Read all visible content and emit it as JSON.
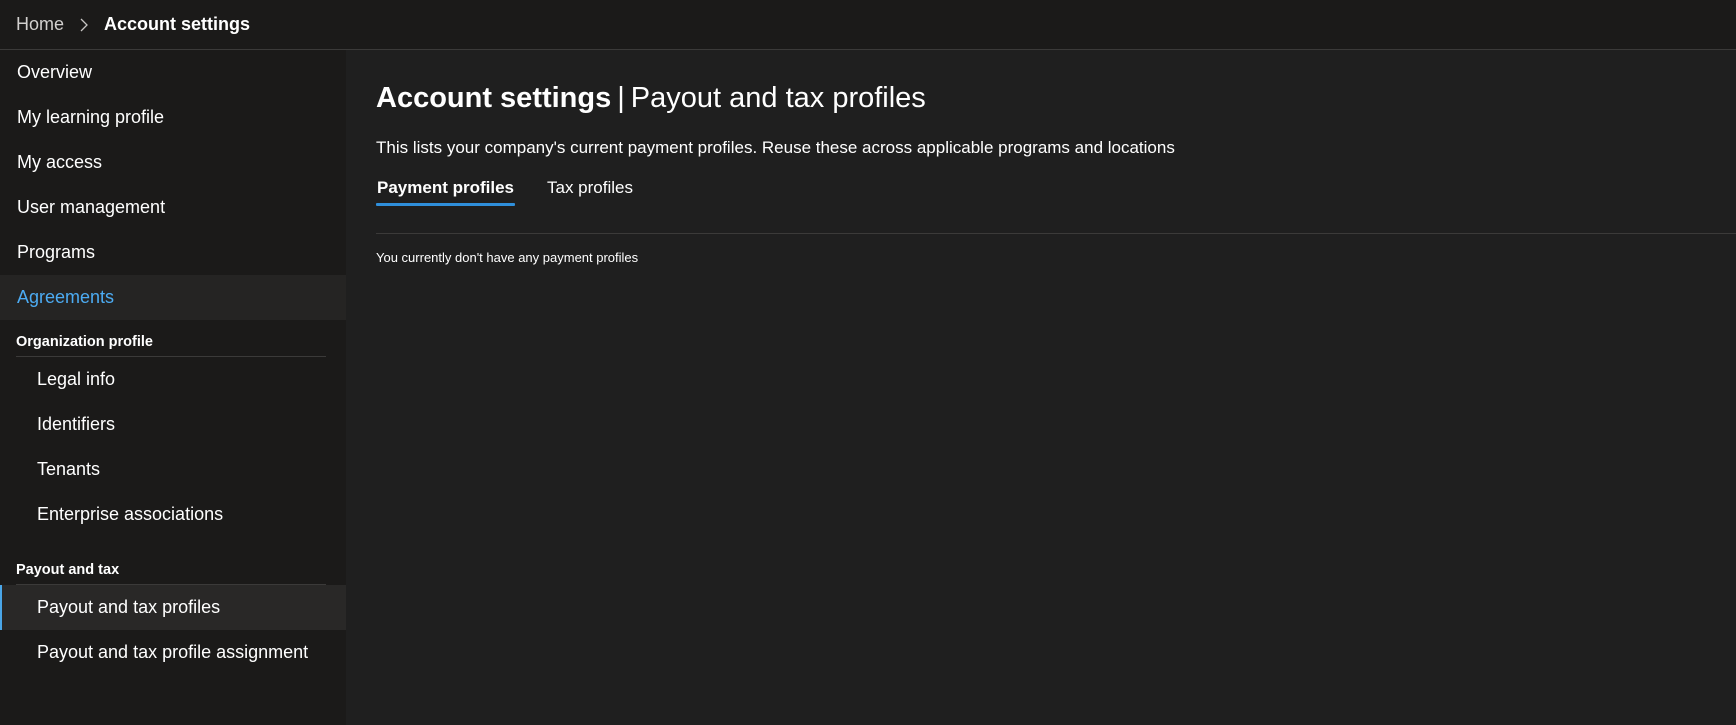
{
  "breadcrumb": {
    "home": "Home",
    "current": "Account settings"
  },
  "sidebar": {
    "items": [
      {
        "label": "Overview"
      },
      {
        "label": "My learning profile"
      },
      {
        "label": "My access"
      },
      {
        "label": "User management"
      },
      {
        "label": "Programs"
      },
      {
        "label": "Agreements"
      }
    ],
    "groups": [
      {
        "header": "Organization profile",
        "items": [
          {
            "label": "Legal info"
          },
          {
            "label": "Identifiers"
          },
          {
            "label": "Tenants"
          },
          {
            "label": "Enterprise associations"
          }
        ]
      },
      {
        "header": "Payout and tax",
        "items": [
          {
            "label": "Payout and tax profiles"
          },
          {
            "label": "Payout and tax profile assignment"
          }
        ]
      }
    ]
  },
  "main": {
    "title": "Account settings",
    "title_separator": "|",
    "subtitle": "Payout and tax profiles",
    "description": "This lists your company's current payment profiles. Reuse these across applicable programs and locations",
    "tabs": [
      {
        "label": "Payment profiles"
      },
      {
        "label": "Tax profiles"
      }
    ],
    "empty_message": "You currently don't have any payment profiles"
  },
  "colors": {
    "accent": "#2f8fdb",
    "link_active": "#4cabf2",
    "background": "#1f1f1f",
    "sidebar_background": "#1b1a19"
  },
  "icons": {
    "breadcrumb_separator": "chevron-right-icon"
  }
}
